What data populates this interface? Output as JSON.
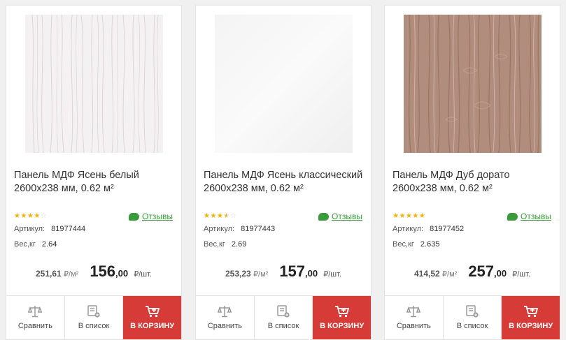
{
  "products": [
    {
      "title": "Панель МДФ Ясень белый 2600x238 мм, 0.62 м²",
      "rating": 4,
      "reviews_label": "Отзывы",
      "sku_label": "Артикул:",
      "sku": "81977444",
      "weight_label": "Вес,кг",
      "weight": "2.64",
      "price_m2": "251,61",
      "price_m2_unit": "₽/м²",
      "price_int": "156",
      "price_cents": ",00",
      "price_unit": "₽/шт.",
      "image_kind": "white-ash-wood-texture"
    },
    {
      "title": "Панель МДФ Ясень классический 2600x238 мм, 0.62 м²",
      "rating": 3.5,
      "reviews_label": "Отзывы",
      "sku_label": "Артикул:",
      "sku": "81977443",
      "weight_label": "Вес,кг",
      "weight": "2.69",
      "price_m2": "253,23",
      "price_m2_unit": "₽/м²",
      "price_int": "157",
      "price_cents": ",00",
      "price_unit": "₽/шт.",
      "image_kind": "plain-white-texture"
    },
    {
      "title": "Панель МДФ Дуб дорато 2600x238 мм, 0.62 м²",
      "rating": 5,
      "reviews_label": "Отзывы",
      "sku_label": "Артикул:",
      "sku": "81977452",
      "weight_label": "Вес,кг",
      "weight": "2.635",
      "price_m2": "414,52",
      "price_m2_unit": "₽/м²",
      "price_int": "257",
      "price_cents": ",00",
      "price_unit": "₽/шт.",
      "image_kind": "dorato-oak-wood-texture"
    }
  ],
  "actions": {
    "compare_label": "Сравнить",
    "list_label": "В список",
    "cart_label": "В КОРЗИНУ"
  },
  "colors": {
    "cart_bg": "#d63b37",
    "stars": "#f5b301",
    "reviews": "#3a9b3a"
  },
  "icons": {
    "compare": "scales-icon",
    "list": "list-add-icon",
    "cart": "cart-add-icon",
    "reviews": "chat-bubble-icon",
    "star": "star-icon"
  }
}
